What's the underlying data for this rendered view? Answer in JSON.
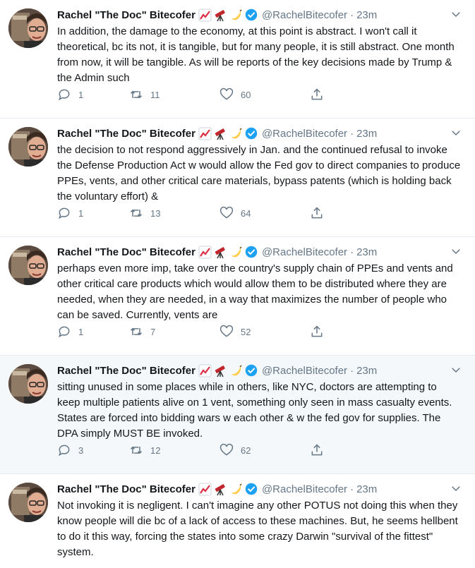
{
  "author": {
    "name": "Rachel \"The Doc\" Bitecofer",
    "handle": "@RachelBitecofer",
    "emoji_icons": [
      "chart-increasing-emoji",
      "telescope-emoji",
      "banana-emoji"
    ],
    "verified_icon": "verified-badge-icon"
  },
  "colors": {
    "text": "#14171a",
    "muted": "#657786",
    "verified": "#1da1f2",
    "border": "#e6ecf0",
    "highlight_bg": "#f5f8fa"
  },
  "tweets": [
    {
      "time": "23m",
      "text": "In addition, the damage to the economy, at this point is abstract. I won't call it theoretical, bc its not, it is tangible, but for many people, it is still abstract. One month from now, it will be tangible. As will be reports of the key decisions made by Trump & the Admin such",
      "replies": "1",
      "retweets": "11",
      "likes": "60"
    },
    {
      "time": "23m",
      "text": "the decision to not respond aggressively in Jan. and the continued refusal to invoke the Defense Production Act w would allow the Fed gov to direct companies to produce PPEs, vents, and other critical care materials, bypass patents (which is holding back the voluntary effort) &",
      "replies": "1",
      "retweets": "13",
      "likes": "64"
    },
    {
      "time": "23m",
      "text": "perhaps even more imp, take over the country's supply chain of PPEs and vents and other critical care products which would allow them to be distributed where they are needed, when they are needed, in a way that maximizes the number of people who can be saved. Currently, vents are",
      "replies": "1",
      "retweets": "7",
      "likes": "52"
    },
    {
      "time": "23m",
      "text": "sitting unused in some places while in others, like NYC, doctors are attempting to keep multiple patients alive on 1 vent, something only seen in mass casualty events. States are forced into bidding wars w each other & w the fed gov for supplies. The DPA simply MUST BE invoked.",
      "replies": "3",
      "retweets": "12",
      "likes": "62"
    },
    {
      "time": "23m",
      "text": "Not invoking it is negligent. I can't imagine any other POTUS not doing this when they know people will die bc of a lack of access to these machines. But, he seems hellbent to do it this way, forcing the states into some crazy Darwin \"survival of the fittest\" system.",
      "replies": "",
      "retweets": "",
      "likes": ""
    }
  ]
}
